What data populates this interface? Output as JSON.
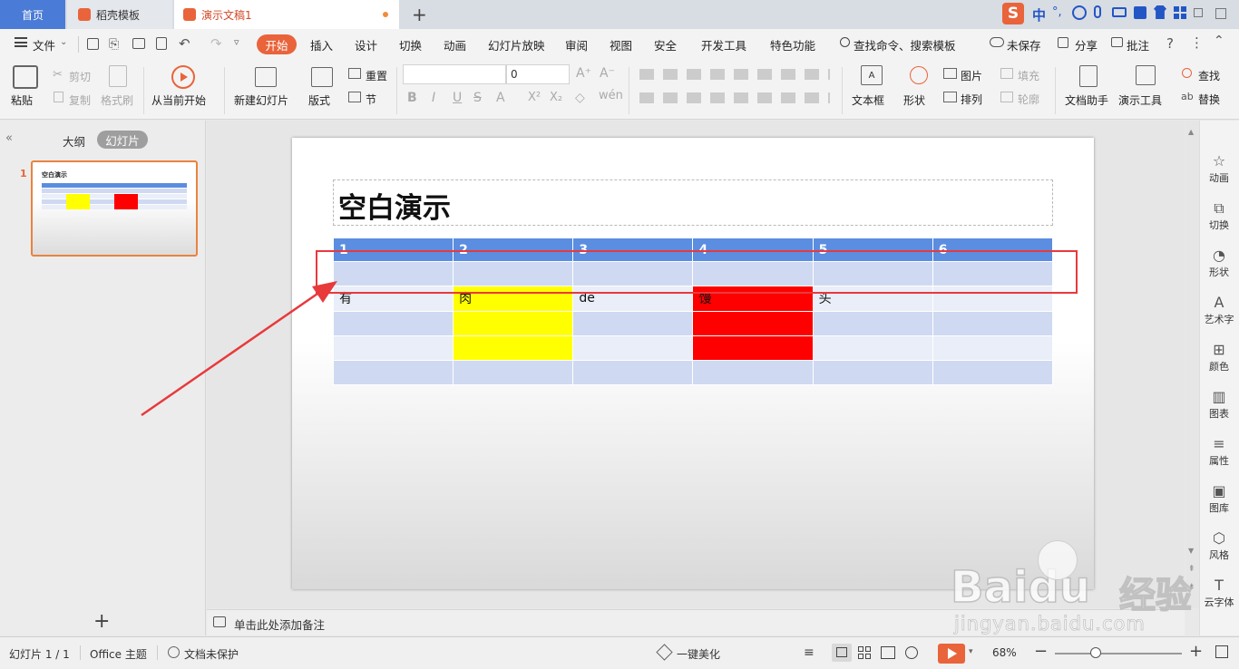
{
  "tabs": {
    "home": "首页",
    "templates": "稻壳模板",
    "document": "演示文稿1",
    "new_tab": "+"
  },
  "ime": {
    "logo": "S",
    "mode": "中",
    "punct": "°,"
  },
  "menu": {
    "file": "文件",
    "items": [
      "开始",
      "插入",
      "设计",
      "切换",
      "动画",
      "幻灯片放映",
      "审阅",
      "视图",
      "安全",
      "开发工具",
      "特色功能"
    ],
    "search": "查找命令、搜索模板",
    "unsaved": "未保存",
    "share": "分享",
    "comment": "批注"
  },
  "ribbon": {
    "paste": "粘贴",
    "cut": "剪切",
    "copy": "复制",
    "format_painter": "格式刷",
    "from_current": "从当前开始",
    "new_slide": "新建幻灯片",
    "layout": "版式",
    "reset": "重置",
    "section": "节",
    "font_size": "0",
    "textbox": "文本框",
    "shape": "形状",
    "picture": "图片",
    "arrange": "排列",
    "fill": "填充",
    "outline": "轮廓",
    "doc_assistant": "文档助手",
    "present_tools": "演示工具",
    "find": "查找",
    "replace": "替换"
  },
  "left_panel": {
    "outline_tab": "大纲",
    "slides_tab": "幻灯片",
    "slide_number": "1",
    "thumb_title": "空白演示",
    "add": "+"
  },
  "slide": {
    "title": "空白演示",
    "table": {
      "header": [
        "1",
        "2",
        "3",
        "4",
        "5",
        "6"
      ],
      "rows": [
        [
          "",
          "",
          "",
          "",
          "",
          ""
        ],
        [
          "有",
          "肉",
          "de",
          "馒",
          "头",
          ""
        ],
        [
          "",
          "",
          "",
          "",
          "",
          ""
        ],
        [
          "",
          "",
          "",
          "",
          "",
          ""
        ],
        [
          "",
          "",
          "",
          "",
          "",
          ""
        ]
      ]
    }
  },
  "notes": {
    "placeholder": "单击此处添加备注"
  },
  "right_sidebar": [
    "动画",
    "切换",
    "形状",
    "艺术字",
    "颜色",
    "图表",
    "属性",
    "图库",
    "风格",
    "云字体"
  ],
  "status": {
    "slide_count": "幻灯片 1 / 1",
    "theme": "Office 主题",
    "protection": "文档未保护",
    "beautify": "一键美化",
    "zoom": "68%"
  },
  "watermark": {
    "brand": "Baidu",
    "brand_cn": "经验",
    "url": "jingyan.baidu.com"
  },
  "colors": {
    "accent": "#e9643b",
    "table_header": "#5b8de0",
    "highlight_yellow": "#ffff00",
    "highlight_red": "#ff0000",
    "annotation": "#e8393c"
  }
}
